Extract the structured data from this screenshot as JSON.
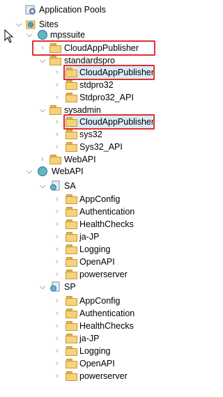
{
  "tree": {
    "app_pools": "Application Pools",
    "sites": "Sites",
    "mpssuite": {
      "label": "mpssuite",
      "children": [
        "CloudAppPublisher",
        "standardspro",
        "CloudAppPublisher",
        "stdpro32",
        "Stdpro32_API",
        "sysadmin",
        "CloudAppPublisher",
        "sys32",
        "Sys32_API",
        "WebAPI"
      ]
    },
    "webapi": {
      "label": "WebAPI",
      "sa": {
        "label": "SA",
        "items": [
          "AppConfig",
          "Authentication",
          "HealthChecks",
          "ja-JP",
          "Logging",
          "OpenAPI",
          "powerserver"
        ]
      },
      "sp": {
        "label": "SP",
        "items": [
          "AppConfig",
          "Authentication",
          "HealthChecks",
          "ja-JP",
          "Logging",
          "OpenAPI",
          "powerserver"
        ]
      }
    }
  },
  "colors": {
    "highlight_box": "#e03030",
    "folder": "#f6d27a",
    "selection": "#dbeaf7"
  }
}
